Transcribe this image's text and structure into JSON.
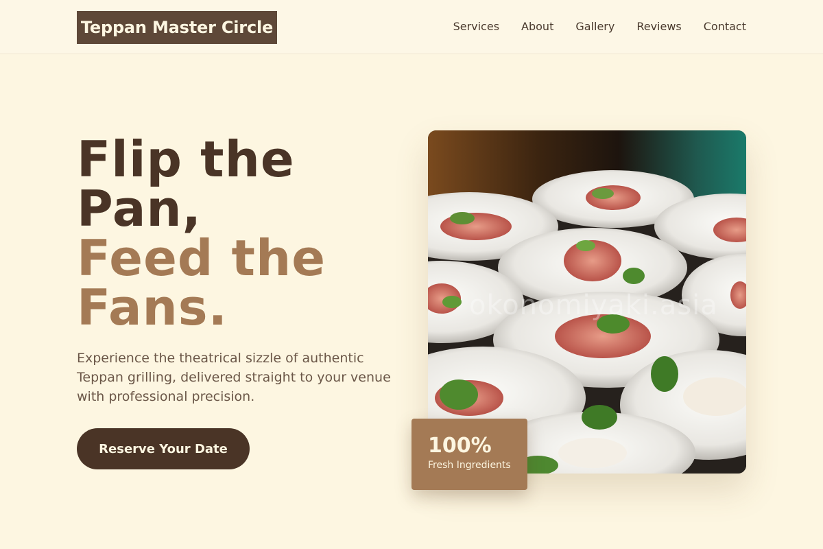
{
  "header": {
    "logo": "Teppan Master Circle",
    "nav": [
      "Services",
      "About",
      "Gallery",
      "Reviews",
      "Contact"
    ]
  },
  "hero": {
    "title_lines": [
      "Flip the",
      "Pan,",
      "Feed the",
      "Fans."
    ],
    "description": "Experience the theatrical sizzle of authentic Teppan grilling, delivered straight to your venue with professional precision.",
    "cta_label": "Reserve Your Date",
    "image_watermark": "okonomiyaki.asia",
    "stat": {
      "value": "100%",
      "label": "Fresh Ingredients"
    }
  },
  "colors": {
    "background": "#fdf6e1",
    "primary": "#4a3426",
    "accent": "#a47a55",
    "logo_bg": "#5e4838"
  }
}
